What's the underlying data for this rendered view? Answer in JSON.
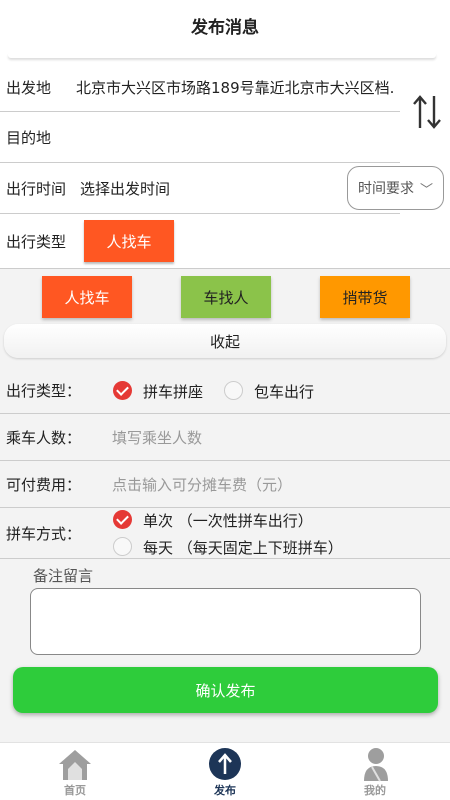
{
  "header": {
    "title": "发布消息"
  },
  "route": {
    "origin_label": "出发地",
    "origin_value": "北京市大兴区市场路189号靠近北京市大兴区档...",
    "destination_label": "目的地",
    "destination_value": "",
    "time_label": "出行时间",
    "time_value": "选择出发时间",
    "time_requirement": "时间要求",
    "type_label": "出行类型",
    "type_selected": "人找车"
  },
  "type_options": [
    {
      "label": "人找车",
      "color": "#ff5722"
    },
    {
      "label": "车找人",
      "color": "#8bc34a"
    },
    {
      "label": "捎带货",
      "color": "#ff9800"
    }
  ],
  "collapse_label": "收起",
  "form": {
    "trip_type_label": "出行类型：",
    "trip_type_options": [
      "拼车拼座",
      "包车出行"
    ],
    "passengers_label": "乘车人数：",
    "passengers_placeholder": "填写乘坐人数",
    "fee_label": "可付费用：",
    "fee_placeholder": "点击输入可分摊车费（元）",
    "carpool_label": "拼车方式：",
    "carpool_options": [
      "单次  （一次性拼车出行）",
      "每天  （每天固定上下班拼车）"
    ],
    "note_label": "备注留言",
    "note_value": ""
  },
  "confirm_label": "确认发布",
  "tabs": [
    {
      "label": "首页",
      "icon": "home-icon"
    },
    {
      "label": "发布",
      "icon": "publish-icon"
    },
    {
      "label": "我的",
      "icon": "profile-icon"
    }
  ],
  "colors": {
    "accent_red": "#e53935",
    "confirm_green": "#2ecc3b",
    "tab_active": "#1d3557"
  }
}
